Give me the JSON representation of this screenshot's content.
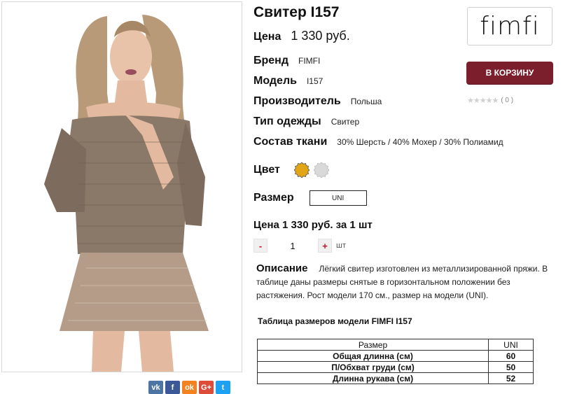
{
  "product": {
    "title": "Свитер I157",
    "price_label": "Цена",
    "price_value": "1 330 руб.",
    "specs": [
      {
        "label": "Бренд",
        "value": "FIMFI"
      },
      {
        "label": "Модель",
        "value": "I157"
      },
      {
        "label": "Производитель",
        "value": "Польша"
      },
      {
        "label": "Тип одежды",
        "value": "Свитер"
      },
      {
        "label": "Состав ткани",
        "value": "30% Шерсть / 40% Мохер / 30% Полиамид"
      }
    ],
    "color_label": "Цвет",
    "colors": [
      "#e2a516",
      "#d9d9d9"
    ],
    "size_label": "Размер",
    "size_value": "UNI",
    "total_line": "Цена 1 330 руб. за 1 шт",
    "qty_minus": "-",
    "qty_value": "1",
    "qty_plus": "+",
    "qty_unit": "шт",
    "description_label": "Описание",
    "description_text": "Лёгкий свитер изготовлен из металлизированной пряжи. В таблице даны размеры снятые в горизонтальном положении без растяжения. Рост модели 170 см., размер на модели (UNI)."
  },
  "size_table": {
    "title": "Таблица размеров модели FIMFI  I157",
    "headers": [
      "Размер",
      "UNI"
    ],
    "rows": [
      [
        "Общая длинна (см)",
        "60"
      ],
      [
        "П/Обхват груди (см)",
        "50"
      ],
      [
        "Длинна рукава (см)",
        "52"
      ]
    ]
  },
  "sidebar": {
    "logo_text": "fimfi",
    "cart_button": "В КОРЗИНУ",
    "stars": "★★★★★",
    "rating_count": "( 0 )"
  },
  "share": [
    {
      "icon": "vk-icon",
      "glyph": "vk",
      "color": "#4c75a3"
    },
    {
      "icon": "facebook-icon",
      "glyph": "f",
      "color": "#3b5998"
    },
    {
      "icon": "odnoklassniki-icon",
      "glyph": "ok",
      "color": "#f58220"
    },
    {
      "icon": "google-plus-icon",
      "glyph": "G+",
      "color": "#dd4b39"
    },
    {
      "icon": "twitter-icon",
      "glyph": "t",
      "color": "#1da1f2"
    }
  ]
}
